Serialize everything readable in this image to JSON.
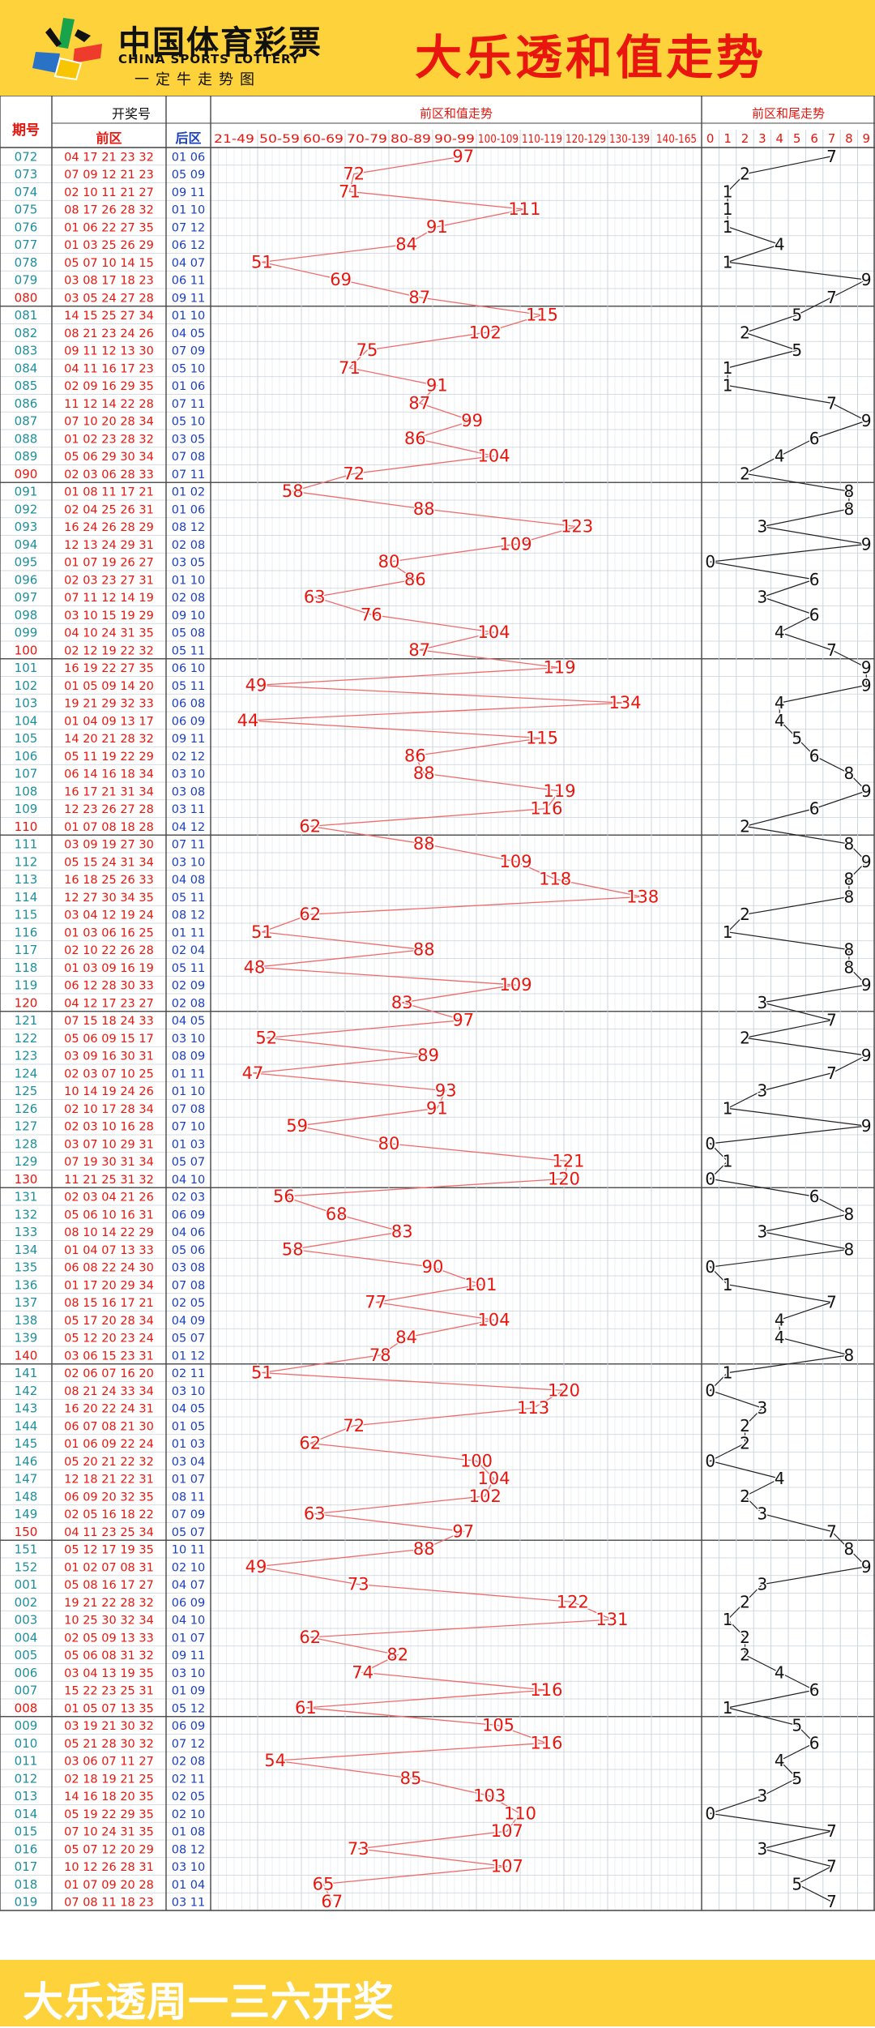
{
  "header": {
    "logo_cn": "中国体育彩票",
    "logo_en": "CHINA SPORTS LOTTERY",
    "logo_sub": "一定牛走势图",
    "title": "大乐透和值走势"
  },
  "footer": {
    "text": "大乐透周一三六开奖"
  },
  "colors": {
    "banner": "#fdd23a",
    "red": "#e8160e",
    "teal": "#1e8f9c",
    "blue": "#1a3fbf",
    "grid": "#c7d1da"
  },
  "table": {
    "col_issue": "期号",
    "col_draw": "开奖号",
    "col_front": "前区",
    "col_back": "后区",
    "col_sum_title": "前区和值走势",
    "col_tail_title": "前区和尾走势",
    "sum_bins": [
      "21-49",
      "50-59",
      "60-69",
      "70-79",
      "80-89",
      "90-99",
      "100-109",
      "110-119",
      "120-129",
      "130-139",
      "140-165"
    ],
    "tail_digits": [
      "0",
      "1",
      "2",
      "3",
      "4",
      "5",
      "6",
      "7",
      "8",
      "9"
    ]
  },
  "chart_data": {
    "type": "line",
    "title": "大乐透和值走势",
    "series": [
      {
        "name": "前区和值走势",
        "values": [
          97,
          72,
          71,
          111,
          91,
          84,
          51,
          69,
          87,
          115,
          102,
          75,
          71,
          91,
          87,
          99,
          86,
          104,
          72,
          58,
          88,
          123,
          109,
          80,
          86,
          63,
          76,
          104,
          87,
          119,
          49,
          134,
          44,
          115,
          86,
          88,
          119,
          116,
          62,
          88,
          109,
          118,
          138,
          62,
          51,
          88,
          48,
          109,
          83,
          97,
          52,
          89,
          47,
          93,
          91,
          59,
          80,
          121,
          120,
          56,
          68,
          83,
          58,
          90,
          101,
          77,
          104,
          84,
          78,
          51,
          120,
          113,
          72,
          62,
          100,
          104,
          102,
          63,
          97,
          88,
          49,
          73,
          122,
          131,
          62,
          82,
          74,
          116,
          61,
          105,
          116,
          54,
          85,
          103,
          110,
          107,
          73,
          107,
          65,
          67
        ]
      },
      {
        "name": "前区和尾走势",
        "values": [
          7,
          2,
          1,
          1,
          1,
          4,
          1,
          9,
          7,
          5,
          2,
          5,
          1,
          1,
          7,
          9,
          6,
          4,
          2,
          8,
          8,
          3,
          9,
          0,
          6,
          3,
          6,
          4,
          7,
          9,
          9,
          4,
          4,
          5,
          6,
          8,
          9,
          6,
          2,
          8,
          9,
          8,
          8,
          2,
          1,
          8,
          8,
          9,
          3,
          7,
          2,
          9,
          7,
          3,
          1,
          9,
          0,
          1,
          0,
          6,
          8,
          3,
          8,
          0,
          1,
          7,
          4,
          4,
          8,
          1,
          0,
          3,
          2,
          2,
          0,
          4,
          2,
          3,
          7,
          8,
          9,
          3,
          2,
          1,
          2,
          2,
          4,
          6,
          1,
          5,
          6,
          4,
          5,
          3,
          0,
          7,
          3,
          7,
          5,
          7
        ]
      }
    ],
    "rows": [
      {
        "issue": "072",
        "front": "04 17 21 23 32",
        "back": "01 06"
      },
      {
        "issue": "073",
        "front": "07 09 12 21 23",
        "back": "05 09"
      },
      {
        "issue": "074",
        "front": "02 10 11 21 27",
        "back": "09 11"
      },
      {
        "issue": "075",
        "front": "08 17 26 28 32",
        "back": "01 10"
      },
      {
        "issue": "076",
        "front": "01 06 22 27 35",
        "back": "07 12"
      },
      {
        "issue": "077",
        "front": "01 03 25 26 29",
        "back": "06 12"
      },
      {
        "issue": "078",
        "front": "05 07 10 14 15",
        "back": "04 07"
      },
      {
        "issue": "079",
        "front": "03 08 17 18 23",
        "back": "06 11"
      },
      {
        "issue": "080",
        "front": "03 05 24 27 28",
        "back": "09 11"
      },
      {
        "issue": "081",
        "front": "14 15 25 27 34",
        "back": "01 10"
      },
      {
        "issue": "082",
        "front": "08 21 23 24 26",
        "back": "04 05"
      },
      {
        "issue": "083",
        "front": "09 11 12 13 30",
        "back": "07 09"
      },
      {
        "issue": "084",
        "front": "04 11 16 17 23",
        "back": "05 10"
      },
      {
        "issue": "085",
        "front": "02 09 16 29 35",
        "back": "01 06"
      },
      {
        "issue": "086",
        "front": "11 12 14 22 28",
        "back": "07 11"
      },
      {
        "issue": "087",
        "front": "07 10 20 28 34",
        "back": "05 10"
      },
      {
        "issue": "088",
        "front": "01 02 23 28 32",
        "back": "03 05"
      },
      {
        "issue": "089",
        "front": "05 06 29 30 34",
        "back": "07 08"
      },
      {
        "issue": "090",
        "front": "02 03 06 28 33",
        "back": "07 11"
      },
      {
        "issue": "091",
        "front": "01 08 11 17 21",
        "back": "01 02"
      },
      {
        "issue": "092",
        "front": "02 04 25 26 31",
        "back": "01 06"
      },
      {
        "issue": "093",
        "front": "16 24 26 28 29",
        "back": "08 12"
      },
      {
        "issue": "094",
        "front": "12 13 24 29 31",
        "back": "02 08"
      },
      {
        "issue": "095",
        "front": "01 07 19 26 27",
        "back": "03 05"
      },
      {
        "issue": "096",
        "front": "02 03 23 27 31",
        "back": "01 10"
      },
      {
        "issue": "097",
        "front": "07 11 12 14 19",
        "back": "02 08"
      },
      {
        "issue": "098",
        "front": "03 10 15 19 29",
        "back": "09 10"
      },
      {
        "issue": "099",
        "front": "04 10 24 31 35",
        "back": "05 08"
      },
      {
        "issue": "100",
        "front": "02 12 19 22 32",
        "back": "05 11"
      },
      {
        "issue": "101",
        "front": "16 19 22 27 35",
        "back": "06 10"
      },
      {
        "issue": "102",
        "front": "01 05 09 14 20",
        "back": "05 11"
      },
      {
        "issue": "103",
        "front": "19 21 29 32 33",
        "back": "06 08"
      },
      {
        "issue": "104",
        "front": "01 04 09 13 17",
        "back": "06 09"
      },
      {
        "issue": "105",
        "front": "14 20 21 28 32",
        "back": "09 11"
      },
      {
        "issue": "106",
        "front": "05 11 19 22 29",
        "back": "02 12"
      },
      {
        "issue": "107",
        "front": "06 14 16 18 34",
        "back": "03 10"
      },
      {
        "issue": "108",
        "front": "16 17 21 31 34",
        "back": "03 08"
      },
      {
        "issue": "109",
        "front": "12 23 26 27 28",
        "back": "03 11"
      },
      {
        "issue": "110",
        "front": "01 07 08 18 28",
        "back": "04 12"
      },
      {
        "issue": "111",
        "front": "03 09 19 27 30",
        "back": "07 11"
      },
      {
        "issue": "112",
        "front": "05 15 24 31 34",
        "back": "03 10"
      },
      {
        "issue": "113",
        "front": "16 18 25 26 33",
        "back": "04 08"
      },
      {
        "issue": "114",
        "front": "12 27 30 34 35",
        "back": "05 11"
      },
      {
        "issue": "115",
        "front": "03 04 12 19 24",
        "back": "08 12"
      },
      {
        "issue": "116",
        "front": "01 03 06 16 25",
        "back": "01 11"
      },
      {
        "issue": "117",
        "front": "02 10 22 26 28",
        "back": "02 04"
      },
      {
        "issue": "118",
        "front": "01 03 09 16 19",
        "back": "05 11"
      },
      {
        "issue": "119",
        "front": "06 12 28 30 33",
        "back": "02 09"
      },
      {
        "issue": "120",
        "front": "04 12 17 23 27",
        "back": "02 08"
      },
      {
        "issue": "121",
        "front": "07 15 18 24 33",
        "back": "04 05"
      },
      {
        "issue": "122",
        "front": "05 06 09 15 17",
        "back": "03 10"
      },
      {
        "issue": "123",
        "front": "03 09 16 30 31",
        "back": "08 09"
      },
      {
        "issue": "124",
        "front": "02 03 07 10 25",
        "back": "01 11"
      },
      {
        "issue": "125",
        "front": "10 14 19 24 26",
        "back": "01 10"
      },
      {
        "issue": "126",
        "front": "02 10 17 28 34",
        "back": "07 08"
      },
      {
        "issue": "127",
        "front": "02 03 10 16 28",
        "back": "07 10"
      },
      {
        "issue": "128",
        "front": "03 07 10 29 31",
        "back": "01 03"
      },
      {
        "issue": "129",
        "front": "07 19 30 31 34",
        "back": "05 07"
      },
      {
        "issue": "130",
        "front": "11 21 25 31 32",
        "back": "04 10"
      },
      {
        "issue": "131",
        "front": "02 03 04 21 26",
        "back": "02 03"
      },
      {
        "issue": "132",
        "front": "05 06 10 16 31",
        "back": "06 09"
      },
      {
        "issue": "133",
        "front": "08 10 14 22 29",
        "back": "04 06"
      },
      {
        "issue": "134",
        "front": "01 04 07 13 33",
        "back": "05 06"
      },
      {
        "issue": "135",
        "front": "06 08 22 24 30",
        "back": "03 08"
      },
      {
        "issue": "136",
        "front": "01 17 20 29 34",
        "back": "07 08"
      },
      {
        "issue": "137",
        "front": "08 15 16 17 21",
        "back": "02 05"
      },
      {
        "issue": "138",
        "front": "05 17 20 28 34",
        "back": "04 09"
      },
      {
        "issue": "139",
        "front": "05 12 20 23 24",
        "back": "05 07"
      },
      {
        "issue": "140",
        "front": "03 06 15 23 31",
        "back": "01 12"
      },
      {
        "issue": "141",
        "front": "02 06 07 16 20",
        "back": "02 11"
      },
      {
        "issue": "142",
        "front": "08 21 24 33 34",
        "back": "03 10"
      },
      {
        "issue": "143",
        "front": "16 20 22 24 31",
        "back": "04 05"
      },
      {
        "issue": "144",
        "front": "06 07 08 21 30",
        "back": "01 05"
      },
      {
        "issue": "145",
        "front": "01 06 09 22 24",
        "back": "01 03"
      },
      {
        "issue": "146",
        "front": "05 20 21 22 32",
        "back": "03 04"
      },
      {
        "issue": "147",
        "front": "12 18 21 22 31",
        "back": "01 07"
      },
      {
        "issue": "148",
        "front": "06 09 20 32 35",
        "back": "08 11"
      },
      {
        "issue": "149",
        "front": "02 05 16 18 22",
        "back": "07 09"
      },
      {
        "issue": "150",
        "front": "04 11 23 25 34",
        "back": "05 07"
      },
      {
        "issue": "151",
        "front": "05 12 17 19 35",
        "back": "10 11"
      },
      {
        "issue": "152",
        "front": "01 02 07 08 31",
        "back": "02 10"
      },
      {
        "issue": "001",
        "front": "05 08 16 17 27",
        "back": "04 07"
      },
      {
        "issue": "002",
        "front": "19 21 22 28 32",
        "back": "06 09"
      },
      {
        "issue": "003",
        "front": "10 25 30 32 34",
        "back": "04 10"
      },
      {
        "issue": "004",
        "front": "02 05 09 13 33",
        "back": "01 07"
      },
      {
        "issue": "005",
        "front": "05 06 08 31 32",
        "back": "09 11"
      },
      {
        "issue": "006",
        "front": "03 04 13 19 35",
        "back": "03 10"
      },
      {
        "issue": "007",
        "front": "15 22 23 25 31",
        "back": "01 09"
      },
      {
        "issue": "008",
        "front": "01 05 07 13 35",
        "back": "05 12"
      },
      {
        "issue": "009",
        "front": "03 19 21 30 32",
        "back": "06 09"
      },
      {
        "issue": "010",
        "front": "05 21 28 30 32",
        "back": "07 12"
      },
      {
        "issue": "011",
        "front": "03 06 07 11 27",
        "back": "02 08"
      },
      {
        "issue": "012",
        "front": "02 18 19 21 25",
        "back": "02 11"
      },
      {
        "issue": "013",
        "front": "14 16 18 20 35",
        "back": "02 05"
      },
      {
        "issue": "014",
        "front": "05 19 22 29 35",
        "back": "02 10"
      },
      {
        "issue": "015",
        "front": "07 10 24 31 35",
        "back": "01 08"
      },
      {
        "issue": "016",
        "front": "05 07 12 20 29",
        "back": "08 12"
      },
      {
        "issue": "017",
        "front": "10 12 26 28 31",
        "back": "03 10"
      },
      {
        "issue": "018",
        "front": "01 07 09 20 28",
        "back": "01 04"
      },
      {
        "issue": "019",
        "front": "07 08 11 18 23",
        "back": "03 11"
      }
    ]
  }
}
